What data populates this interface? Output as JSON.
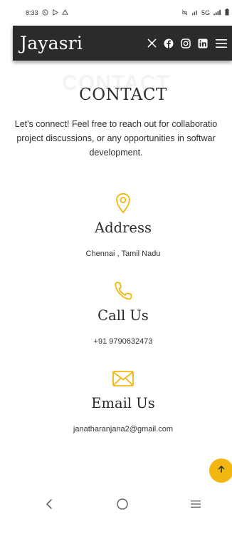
{
  "status_bar": {
    "time": "8:33",
    "network": "5G"
  },
  "header": {
    "brand": "Jayasri",
    "social_icons": [
      "x-icon",
      "facebook-icon",
      "instagram-icon",
      "linkedin-icon"
    ],
    "menu_icon": "hamburger-menu-icon"
  },
  "section": {
    "background_title": "CONTACT",
    "title": "CONTACT",
    "intro_lines": [
      "Let's connect! Feel free to reach out for collaboratio",
      "project discussions, or any opportunities in softwar",
      "development."
    ]
  },
  "contacts": [
    {
      "icon": "map-pin-icon",
      "heading": "Address",
      "value": "Chennai , Tamil Nadu"
    },
    {
      "icon": "phone-icon",
      "heading": "Call Us",
      "value": "+91 9790632473"
    },
    {
      "icon": "envelope-icon",
      "heading": "Email Us",
      "value": "janatharanjana2@gmail.com"
    }
  ],
  "colors": {
    "accent": "#f3b712",
    "header_bg": "#2b2b2b"
  },
  "scroll_top_icon": "arrow-up-icon",
  "nav": {
    "back_icon": "back-chevron-icon",
    "home_icon": "home-circle-icon",
    "recents_icon": "recents-lines-icon"
  }
}
